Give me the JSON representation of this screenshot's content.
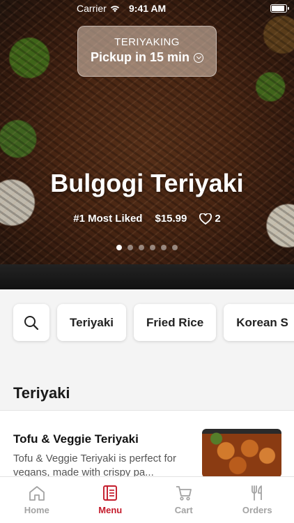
{
  "status_bar": {
    "carrier": "Carrier",
    "time": "9:41 AM"
  },
  "pickup": {
    "store": "TERIYAKING",
    "time_label": "Pickup in 15 min"
  },
  "hero": {
    "title": "Bulgogi Teriyaki",
    "badge": "#1 Most Liked",
    "price": "$15.99",
    "likes": "2",
    "slide_count": 6,
    "active_slide": 1
  },
  "categories": [
    "Teriyaki",
    "Fried Rice",
    "Korean S"
  ],
  "section": {
    "title": "Teriyaki"
  },
  "items": [
    {
      "name": "Tofu & Veggie Teriyaki",
      "description": "Tofu & Veggie Teriyaki is perfect for vegans, made with crispy pa..."
    }
  ],
  "tabs": [
    {
      "label": "Home",
      "icon": "home-icon",
      "active": false
    },
    {
      "label": "Menu",
      "icon": "menu-icon",
      "active": true
    },
    {
      "label": "Cart",
      "icon": "cart-icon",
      "active": false
    },
    {
      "label": "Orders",
      "icon": "utensils-icon",
      "active": false
    }
  ],
  "colors": {
    "accent": "#c41b2b",
    "inactive_tab": "#a3a3a3"
  }
}
